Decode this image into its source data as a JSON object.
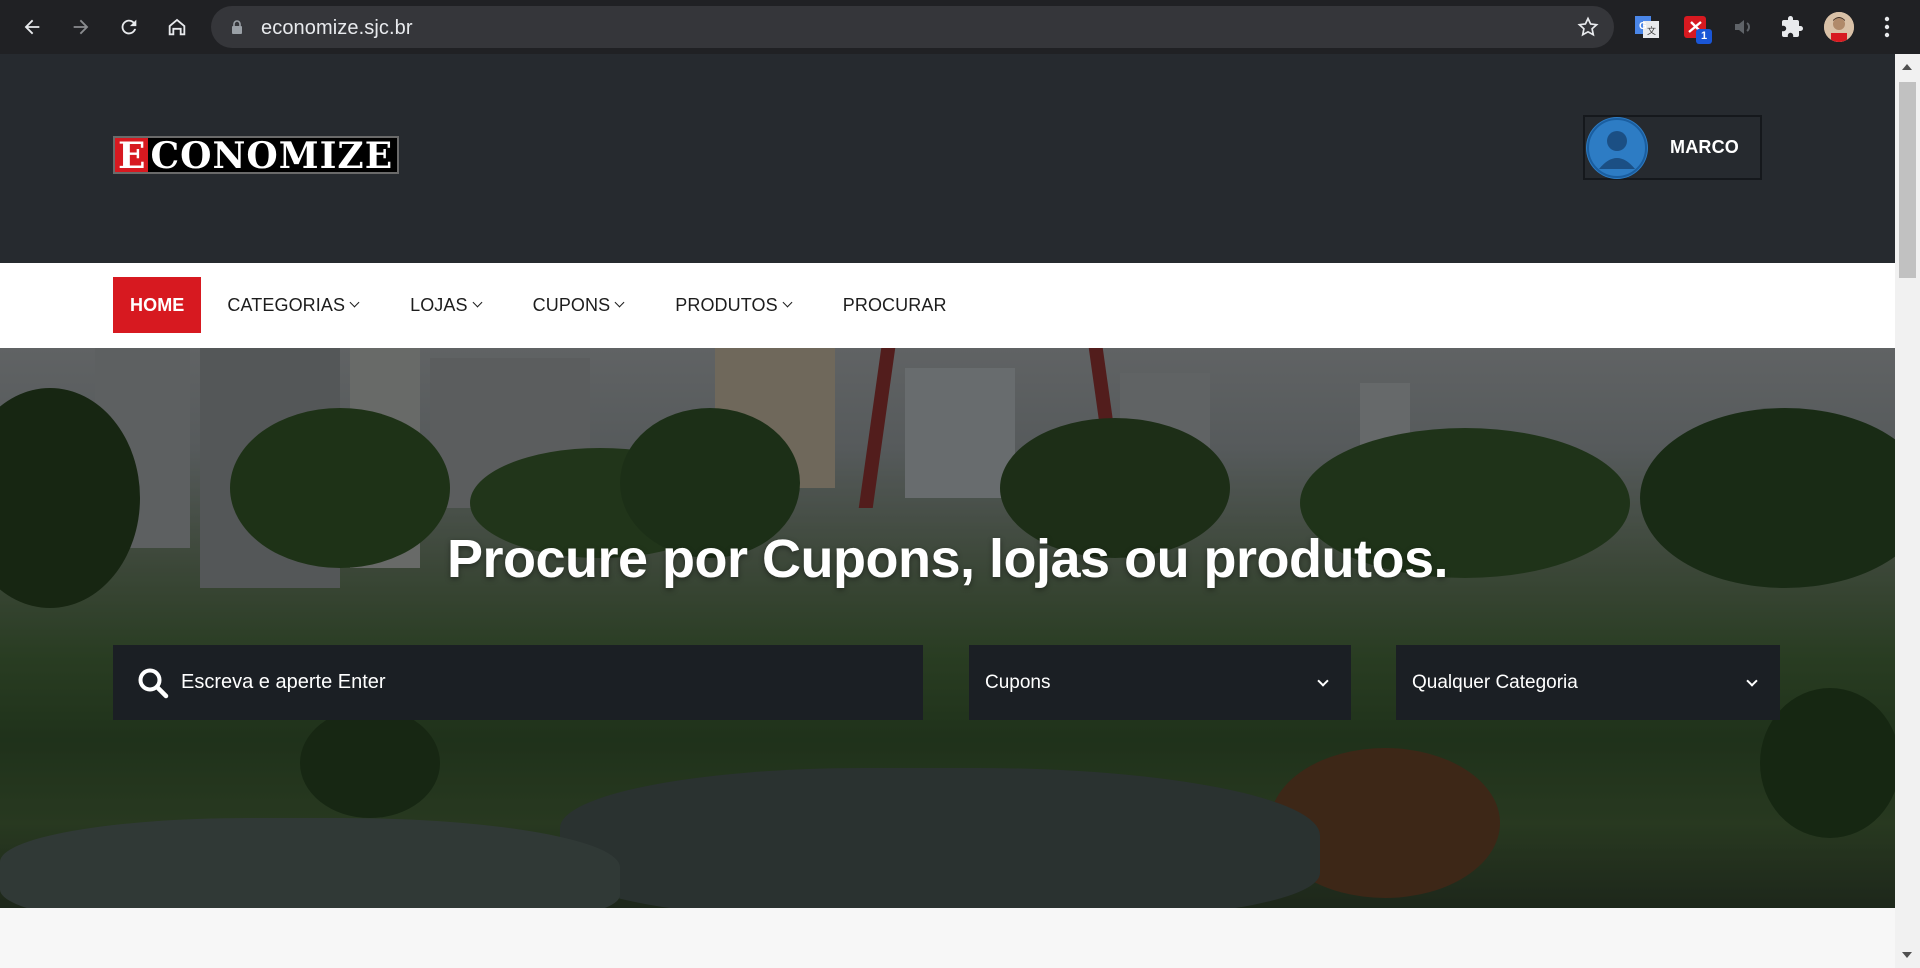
{
  "browser": {
    "url": "economize.sjc.br",
    "extensions": [
      {
        "name": "google-translate-icon"
      },
      {
        "name": "coupon-extension-icon",
        "badge": "1"
      },
      {
        "name": "media-icon"
      },
      {
        "name": "puzzle-icon"
      }
    ]
  },
  "site": {
    "logo": {
      "first_letter": "E",
      "rest": "CONOMIZE"
    },
    "user": {
      "name": "MARCO"
    },
    "nav": {
      "home": "HOME",
      "categorias": "CATEGORIAS",
      "lojas": "LOJAS",
      "cupons": "CUPONS",
      "produtos": "PRODUTOS",
      "procurar": "PROCURAR"
    },
    "hero": {
      "title": "Procure por Cupons, lojas ou produtos.",
      "search_placeholder": "Escreva e aperte Enter",
      "type_select": "Cupons",
      "category_select": "Qualquer Categoria"
    }
  },
  "colors": {
    "accent": "#d71920",
    "header_bg": "#262a2f",
    "search_bg": "#1b1f24"
  }
}
